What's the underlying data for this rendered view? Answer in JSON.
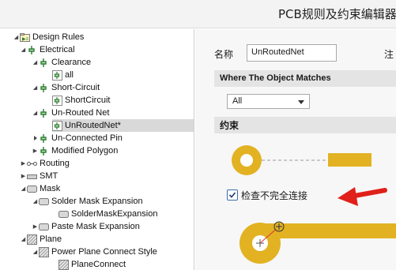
{
  "window": {
    "title": "PCB规则及约束编辑器"
  },
  "tree": {
    "items": [
      {
        "label": "Design Rules",
        "icon": "rules-folder-icon",
        "expanded": true
      },
      {
        "label": "Electrical",
        "icon": "electrical-icon",
        "expanded": true
      },
      {
        "label": "Clearance",
        "icon": "electrical-icon",
        "expanded": true
      },
      {
        "label": "all",
        "icon": "electrical-icon"
      },
      {
        "label": "Short-Circuit",
        "icon": "electrical-icon",
        "expanded": true
      },
      {
        "label": "ShortCircuit",
        "icon": "electrical-icon"
      },
      {
        "label": "Un-Routed Net",
        "icon": "electrical-icon",
        "expanded": true
      },
      {
        "label": "UnRoutedNet*",
        "icon": "electrical-icon",
        "selected": true
      },
      {
        "label": "Un-Connected Pin",
        "icon": "electrical-icon"
      },
      {
        "label": "Modified Polygon",
        "icon": "electrical-icon"
      },
      {
        "label": "Routing",
        "icon": "routing-icon"
      },
      {
        "label": "SMT",
        "icon": "smt-icon"
      },
      {
        "label": "Mask",
        "icon": "mask-icon",
        "expanded": true
      },
      {
        "label": "Solder Mask Expansion",
        "icon": "mask-icon",
        "expanded": true
      },
      {
        "label": "SolderMaskExpansion",
        "icon": "mask-icon"
      },
      {
        "label": "Paste Mask Expansion",
        "icon": "mask-icon"
      },
      {
        "label": "Plane",
        "icon": "plane-icon",
        "expanded": true
      },
      {
        "label": "Power Plane Connect Style",
        "icon": "plane-icon",
        "expanded": true
      },
      {
        "label": "PlaneConnect",
        "icon": "plane-icon"
      }
    ]
  },
  "editor": {
    "name_label": "名称",
    "name_value": "UnRoutedNet",
    "comment_label": "注",
    "where_header": "Where The Object Matches",
    "scope_value": "All",
    "constraints_header": "约束",
    "checkbox_label": "检查不完全连接",
    "checkbox_checked": true
  },
  "colors": {
    "pad": "#e2b223",
    "annotation_arrow": "#e0201a",
    "selection": "#d9d9d9",
    "section_bar": "#e4e4e4"
  }
}
